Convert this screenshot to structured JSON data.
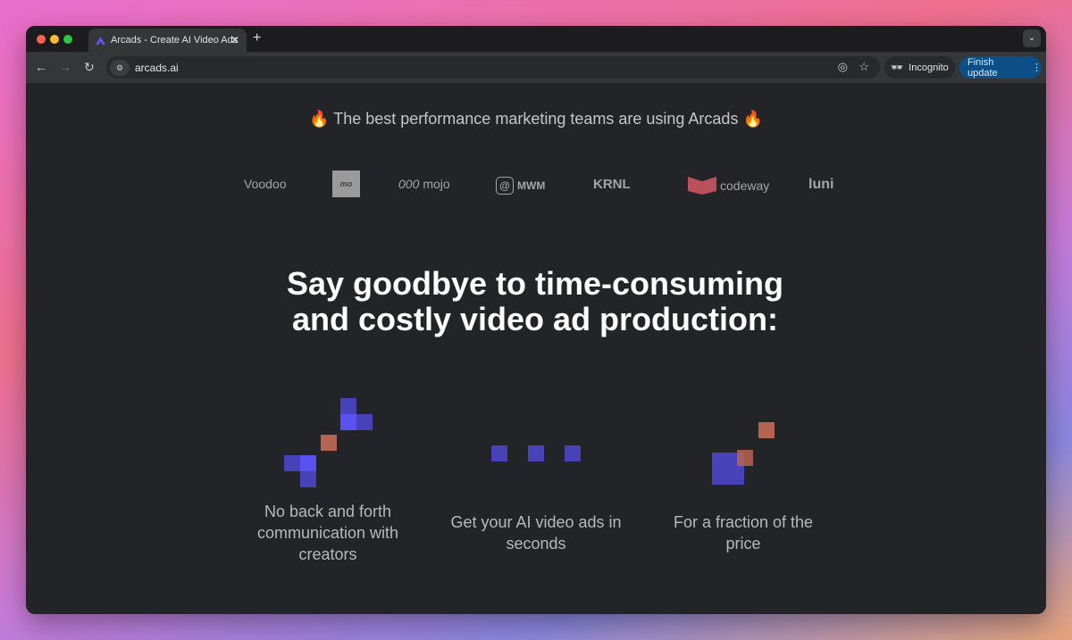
{
  "browser": {
    "tab_title": "Arcads - Create AI Video Ads",
    "url": "arcads.ai",
    "incognito_label": "Incognito",
    "finish_update_label": "Finish update"
  },
  "page": {
    "banner": "🔥 The best performance marketing teams are using Arcads 🔥",
    "logos": [
      "Voodoo",
      "mo",
      "mojo",
      "MWM",
      "KRNL",
      "codeway",
      "luni"
    ],
    "headline": "Say goodbye to time-consuming and costly video ad production:",
    "features": [
      {
        "text": "No back and forth communication with creators"
      },
      {
        "text": "Get your AI video ads in seconds"
      },
      {
        "text": "For a fraction of the price"
      }
    ],
    "colors": {
      "accent_blue": "#4a44c0",
      "accent_orange": "#b56454",
      "background": "#222427"
    }
  }
}
